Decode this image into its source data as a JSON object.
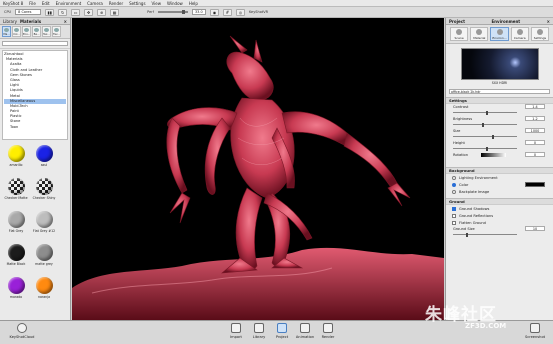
{
  "menubar": {
    "items": [
      "KeyShot 8",
      "File",
      "Edit",
      "Environment",
      "Camera",
      "Render",
      "Settings",
      "View",
      "Window",
      "Help"
    ]
  },
  "toolbar": {
    "cpu_label": "CPU",
    "cpu_value": "8 Cores",
    "perf_label": "Perf",
    "perf_value": "33.0",
    "keyshotvr": "KeyShotVR"
  },
  "library": {
    "title": "Library",
    "tab": "Materials",
    "tabs": [
      "Ma...",
      "Col...",
      "Env...",
      "Ba...",
      "Tex...",
      "Fav..."
    ],
    "tree": [
      "Zbrushtool",
      "Materials",
      "Axalta",
      "Cloth and Leather",
      "Gem Stones",
      "Glass",
      "Light",
      "Liquids",
      "Metal",
      "Miscellaneous",
      "Mold-Tech",
      "Paint",
      "Plastic",
      "Stone",
      "Toon"
    ],
    "selected_index": 9,
    "thumbs": [
      {
        "label": "amarillo",
        "color": "#ffee00"
      },
      {
        "label": "azul",
        "color": "#1a22e6"
      },
      {
        "label": "Checker Matte",
        "color": "checker"
      },
      {
        "label": "Checker Shiny",
        "color": "checker"
      },
      {
        "label": "Flat Grey",
        "color": "#a9a9a9"
      },
      {
        "label": "Flat Grey #12",
        "color": "#bdbdbd"
      },
      {
        "label": "Matte Black",
        "color": "#1c1c1c"
      },
      {
        "label": "matte grey",
        "color": "#8d8d8d"
      },
      {
        "label": "morado",
        "color": "#9920d8"
      },
      {
        "label": "naranja",
        "color": "#ff8a10"
      }
    ]
  },
  "project": {
    "title": "Project",
    "tab": "Environment",
    "tabs": [
      "Scene",
      "Material",
      "Environ...",
      "Camera",
      "Settings"
    ],
    "hdri_name": "SXX HDRI",
    "env_select": "office-black 2k.hdr",
    "settings_header": "Settings",
    "params": [
      {
        "label": "Contrast",
        "value": "1.4",
        "knob": 0.5
      },
      {
        "label": "Brightness",
        "value": "1.2",
        "knob": 0.45
      },
      {
        "label": "Size",
        "value": "1000",
        "knob": 0.6
      },
      {
        "label": "Height",
        "value": "0",
        "knob": 0.5
      }
    ],
    "rotation_label": "Rotation",
    "rotation_value": "0",
    "background_header": "Background",
    "bg_options": [
      {
        "label": "Lighting Environment",
        "on": false
      },
      {
        "label": "Color",
        "on": true
      },
      {
        "label": "Backplate Image",
        "on": false
      }
    ],
    "ground_header": "Ground",
    "ground_options": [
      {
        "label": "Ground Shadows",
        "on": true
      },
      {
        "label": "Ground Reflections",
        "on": false
      },
      {
        "label": "Flatten Ground",
        "on": false
      }
    ],
    "ground_size_label": "Ground Size",
    "ground_size_value": "10"
  },
  "bottom": {
    "cloud": "KeyShotCloud",
    "buttons": [
      "Import",
      "Library",
      "Project",
      "Animation",
      "Render"
    ],
    "active": "Project",
    "screenshot": "Screenshot"
  },
  "watermark": {
    "line1": "朱峰社区",
    "line2": "ZF3D.COM"
  },
  "colors": {
    "creature": "#d9485f",
    "accent": "#2a6fd6",
    "viewport_bg": "#000000"
  }
}
